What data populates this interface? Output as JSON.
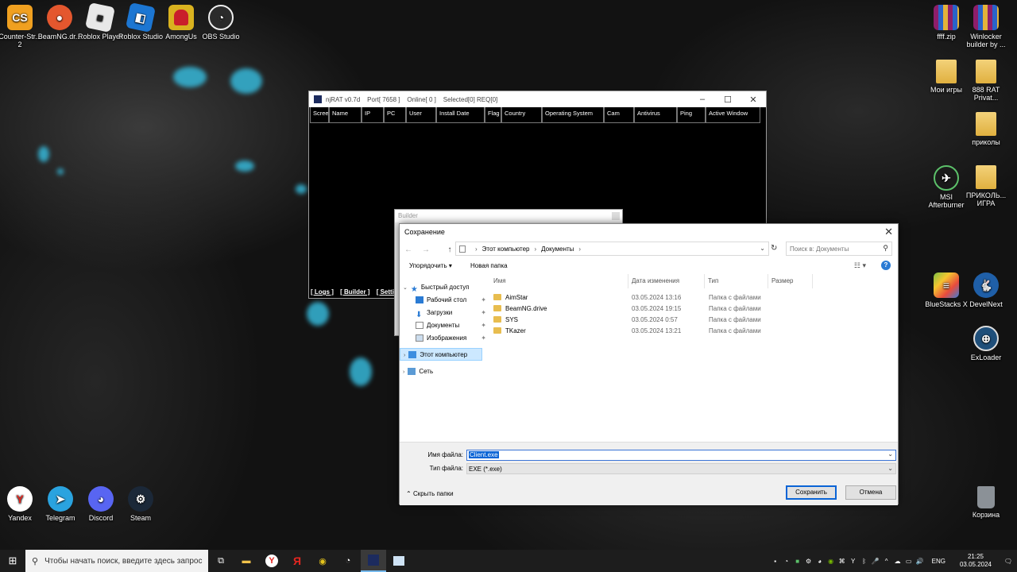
{
  "desktop_icons_top": [
    {
      "label": "Counter-Str... 2",
      "icon": "cs2-icon",
      "color": "#f0a020"
    },
    {
      "label": "BeamNG.dr...",
      "icon": "beamng-icon",
      "color": "#e4572e"
    },
    {
      "label": "Roblox Player",
      "icon": "roblox-icon",
      "color": "#cfcfcf"
    },
    {
      "label": "Roblox Studio",
      "icon": "roblox-studio-icon",
      "color": "#1c76d2"
    },
    {
      "label": "AmongUs",
      "icon": "amongus-icon",
      "color": "#c91f2b"
    },
    {
      "label": "OBS Studio",
      "icon": "obs-icon",
      "color": "#2b2b2b"
    }
  ],
  "desktop_icons_right": [
    {
      "label": "ffff.zip",
      "icon": "winrar-icon"
    },
    {
      "label": "Winlocker builder by ...",
      "icon": "winrar-icon"
    },
    {
      "label": "Мои игры",
      "icon": "folder-icon"
    },
    {
      "label": "888 RAT Privat...",
      "icon": "folder-icon"
    },
    {
      "label": "приколы",
      "icon": "folder-icon"
    },
    {
      "label": "MSI Afterburner",
      "icon": "msi-afterburner-icon"
    },
    {
      "label": "ПРИКОЛЬ... ИГРА",
      "icon": "folder-icon"
    },
    {
      "label": "BlueStacks X",
      "icon": "bluestacks-icon"
    },
    {
      "label": "DevelNext",
      "icon": "develnext-icon"
    },
    {
      "label": "ExLoader",
      "icon": "exloader-icon"
    },
    {
      "label": "Корзина",
      "icon": "recycle-bin-icon"
    }
  ],
  "desktop_icons_bottom": [
    {
      "label": "Yandex",
      "icon": "yandex-icon",
      "color": "#ffffff"
    },
    {
      "label": "Telegram",
      "icon": "telegram-icon",
      "color": "#2aa3df"
    },
    {
      "label": "Discord",
      "icon": "discord-icon",
      "color": "#5865f2"
    },
    {
      "label": "Steam",
      "icon": "steam-icon",
      "color": "#1b2838"
    }
  ],
  "njrat": {
    "title": "njRAT v0.7d    Port[ 7658 ]    Online[ 0 ]    Selected[0] REQ[0]",
    "columns": [
      "Scree",
      "Name",
      "IP",
      "PC",
      "User",
      "Install Date",
      "Flag",
      "Country",
      "Operating System",
      "Cam",
      "Antivirus",
      "Ping",
      "Active Window"
    ],
    "bottom_links": [
      "[ Logs ]",
      "[ Builder ]",
      "[ Settings ]"
    ]
  },
  "builder": {
    "title": "Builder"
  },
  "save_dialog": {
    "title": "Сохранение",
    "breadcrumb": [
      "Этот компьютер",
      "Документы"
    ],
    "search_placeholder": "Поиск в: Документы",
    "organize_label": "Упорядочить ▾",
    "new_folder_label": "Новая папка",
    "sidebar": [
      {
        "label": "Быстрый доступ",
        "icon": "star-icon",
        "pinned": false,
        "level": 0
      },
      {
        "label": "Рабочий стол",
        "icon": "desktop-icon",
        "pinned": true,
        "level": 1
      },
      {
        "label": "Загрузки",
        "icon": "download-icon",
        "pinned": true,
        "level": 1
      },
      {
        "label": "Документы",
        "icon": "documents-icon",
        "pinned": true,
        "level": 1
      },
      {
        "label": "Изображения",
        "icon": "pictures-icon",
        "pinned": true,
        "level": 1
      },
      {
        "label": "Этот компьютер",
        "icon": "computer-icon",
        "pinned": false,
        "level": 0,
        "selected": true
      },
      {
        "label": "Сеть",
        "icon": "network-icon",
        "pinned": false,
        "level": 0
      }
    ],
    "columns": [
      "Имя",
      "Дата изменения",
      "Тип",
      "Размер"
    ],
    "files": [
      {
        "name": "AimStar",
        "date": "03.05.2024 13:16",
        "type": "Папка с файлами"
      },
      {
        "name": "BeamNG.drive",
        "date": "03.05.2024 19:15",
        "type": "Папка с файлами"
      },
      {
        "name": "SYS",
        "date": "03.05.2024 0:57",
        "type": "Папка с файлами"
      },
      {
        "name": "TKazer",
        "date": "03.05.2024 13:21",
        "type": "Папка с файлами"
      }
    ],
    "filename_label": "Имя файла:",
    "filename_value": "Client.exe",
    "filetype_label": "Тип файла:",
    "filetype_value": "EXE (*.exe)",
    "hide_folders_label": "Скрыть папки",
    "save_button": "Сохранить",
    "cancel_button": "Отмена"
  },
  "taskbar": {
    "search_placeholder": "Чтобы начать поиск, введите здесь запрос",
    "lang": "ENG",
    "time": "21:25",
    "date": "03.05.2024"
  }
}
